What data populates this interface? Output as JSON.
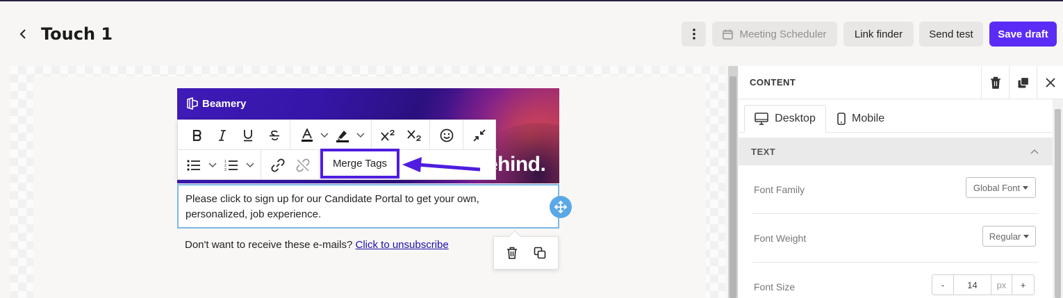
{
  "header": {
    "title": "Touch 1",
    "meeting_scheduler": "Meeting Scheduler",
    "link_finder": "Link finder",
    "send_test": "Send test",
    "save_draft": "Save draft"
  },
  "banner": {
    "logo_text": "Beamery",
    "headline_fragment": "ehind."
  },
  "toolbar": {
    "merge_tags": "Merge Tags"
  },
  "email": {
    "body_line1": "Please click  to sign up for our Candidate Portal to get your own,",
    "body_line2": "personalized, job experience.",
    "unsubscribe_prefix": "Don't want to receive these e-mails?",
    "unsubscribe_link": "Click to unsubscribe"
  },
  "panel": {
    "title": "CONTENT",
    "tabs": [
      {
        "label": "Desktop",
        "active": true
      },
      {
        "label": "Mobile",
        "active": false
      }
    ],
    "section": "TEXT",
    "font_family": {
      "label": "Font Family",
      "value": "Global Font"
    },
    "font_weight": {
      "label": "Font Weight",
      "value": "Regular"
    },
    "font_size": {
      "label": "Font Size",
      "minus": "-",
      "value": "14",
      "unit": "px",
      "plus": "+"
    }
  },
  "colors": {
    "accent": "#5b2cf5",
    "highlight_border": "#4f1de0",
    "selection_border": "#7db6e4"
  }
}
